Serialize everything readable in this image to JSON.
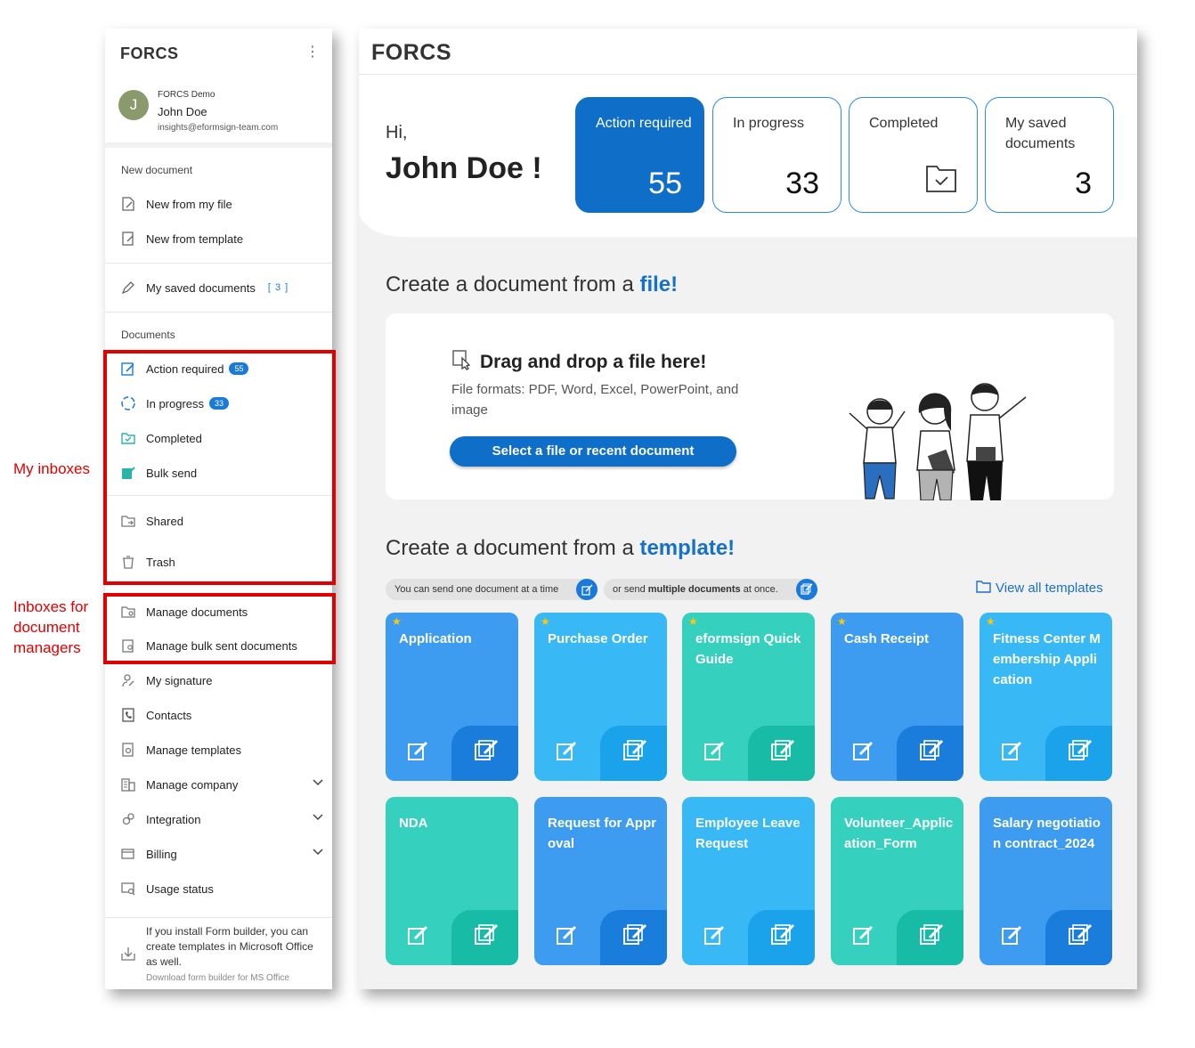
{
  "annotations": {
    "my_inboxes": "My inboxes",
    "managers": "Inboxes for document managers"
  },
  "sidebar": {
    "logo": "FORCS",
    "profile": {
      "avatar_letter": "J",
      "org": "FORCS Demo",
      "name": "John Doe",
      "email": "insights@eformsign-team.com"
    },
    "new_document_title": "New document",
    "new_from_file": "New from my file",
    "new_from_template": "New from template",
    "my_saved": "My saved documents",
    "my_saved_count": "[ 3 ]",
    "documents_title": "Documents",
    "action_required": "Action required",
    "action_required_badge": "55",
    "in_progress": "In progress",
    "in_progress_badge": "33",
    "completed": "Completed",
    "bulk_send": "Bulk send",
    "shared": "Shared",
    "trash": "Trash",
    "manage_documents": "Manage documents",
    "manage_bulk": "Manage bulk sent documents",
    "my_signature": "My signature",
    "contacts": "Contacts",
    "manage_templates": "Manage templates",
    "manage_company": "Manage company",
    "integration": "Integration",
    "billing": "Billing",
    "usage_status": "Usage status",
    "footer_text": "If you install Form builder, you can create templates in Microsoft Office as well.",
    "footer_link": "Download form builder for MS Office"
  },
  "main": {
    "logo": "FORCS",
    "hi": "Hi,",
    "user_name": "John Doe !",
    "stats": [
      {
        "label": "Action required",
        "value": "55"
      },
      {
        "label": "In progress",
        "value": "33"
      },
      {
        "label": "Completed",
        "value": ""
      },
      {
        "label": "My saved documents",
        "value": "3"
      }
    ],
    "file_heading": "Create a document from a ",
    "file_heading_em": "file!",
    "drop_title": "Drag and drop a file here!",
    "drop_sub": "File formats: PDF, Word, Excel, PowerPoint, and image",
    "drop_button": "Select a file or recent document",
    "template_heading": "Create a document from a ",
    "template_heading_em": "template!",
    "chip_one": "You can send one document at a time",
    "chip_multi_pre": "or send ",
    "chip_multi_bold": "multiple documents",
    "chip_multi_post": " at once.",
    "view_all": "View all templates",
    "templates": [
      {
        "title": "Application",
        "star": "★"
      },
      {
        "title": "Purchase Order",
        "star": "★"
      },
      {
        "title": "eformsign Quick Guide",
        "star": "★"
      },
      {
        "title": "Cash Receipt",
        "star": "★"
      },
      {
        "title": "Fitness Center Membership Application",
        "star": "★"
      },
      {
        "title": "NDA",
        "star": ""
      },
      {
        "title": "Request for Approval",
        "star": ""
      },
      {
        "title": "Employee Leave Request",
        "star": ""
      },
      {
        "title": "Volunteer_Application_Form",
        "star": ""
      },
      {
        "title": "Salary negotiation contract_2024",
        "star": ""
      }
    ]
  }
}
